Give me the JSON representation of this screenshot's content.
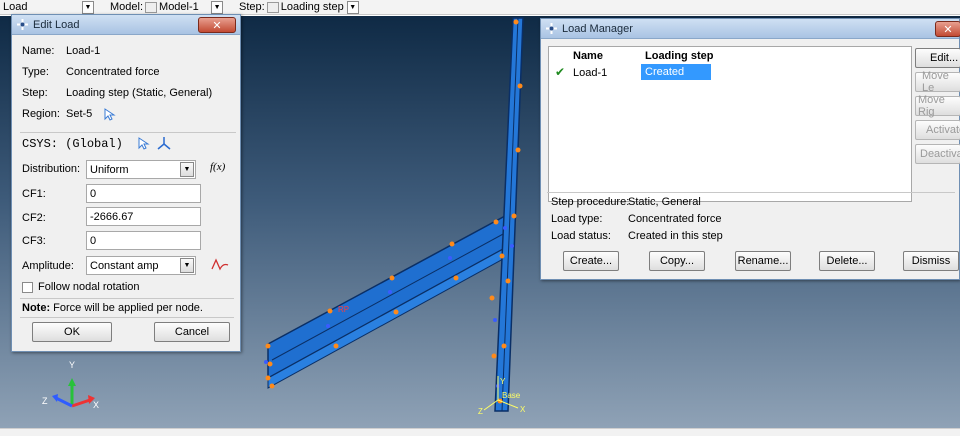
{
  "toolbar": {
    "module_value": "Load",
    "model_label": "Model:",
    "model_value": "Model-1",
    "step_label": "Step:",
    "step_value": "Loading step"
  },
  "edit_load": {
    "title": "Edit Load",
    "name_label": "Name:",
    "name_value": "Load-1",
    "type_label": "Type:",
    "type_value": "Concentrated force",
    "step_label": "Step:",
    "step_value": "Loading step (Static, General)",
    "region_label": "Region:",
    "region_value": "Set-5",
    "csys_label": "CSYS:",
    "csys_value": "(Global)",
    "distribution_label": "Distribution:",
    "distribution_value": "Uniform",
    "fx_label": "f(x)",
    "cf1_label": "CF1:",
    "cf1_value": "0",
    "cf2_label": "CF2:",
    "cf2_value": "-2666.67",
    "cf3_label": "CF3:",
    "cf3_value": "0",
    "amplitude_label": "Amplitude:",
    "amplitude_value": "Constant amp",
    "follow_label": "Follow nodal rotation",
    "follow_checked": false,
    "note_bold": "Note:",
    "note_text": "Force will be applied per node.",
    "ok_label": "OK",
    "cancel_label": "Cancel"
  },
  "load_manager": {
    "title": "Load Manager",
    "columns": [
      "Name",
      "Loading step"
    ],
    "rows": [
      {
        "name": "Load-1",
        "status": "Created"
      }
    ],
    "side_buttons": [
      "Edit...",
      "Move Le",
      "Move Rig",
      "Activate",
      "Deactiva"
    ],
    "step_procedure_label": "Step procedure:",
    "step_procedure_value": "Static, General",
    "load_type_label": "Load type:",
    "load_type_value": "Concentrated force",
    "load_status_label": "Load status:",
    "load_status_value": "Created in this step",
    "bottom_buttons": [
      "Create...",
      "Copy...",
      "Rename...",
      "Delete...",
      "Dismiss"
    ]
  },
  "viewport": {
    "triad": {
      "y": "Y",
      "z": "Z",
      "x": "X"
    },
    "annotation_ramp": "RP",
    "annotation_base": "Base",
    "base_y": "Y",
    "base_x": "X",
    "base_z": "Z"
  },
  "colors": {
    "member_face": "#1f6fd0",
    "member_edge": "#0a2f66",
    "node_marker": "#ff8a1a",
    "selection": "#3399ff"
  }
}
